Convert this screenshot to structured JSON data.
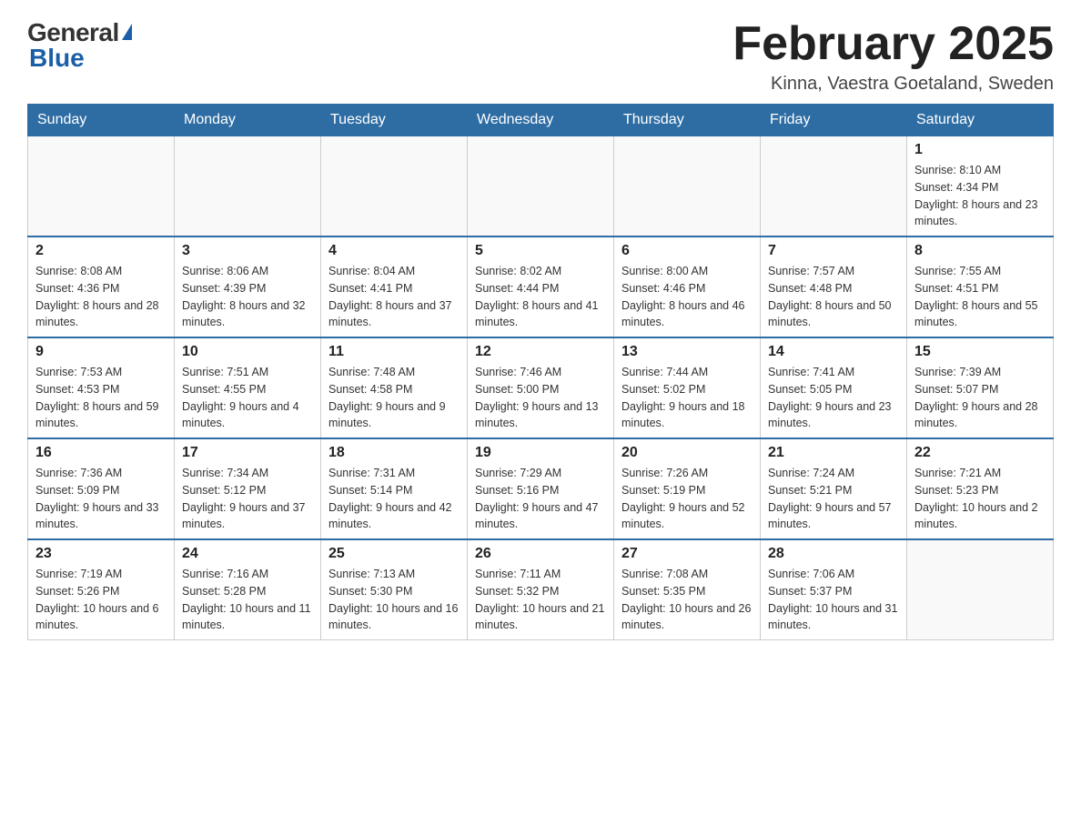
{
  "header": {
    "logo_general": "General",
    "logo_triangle": "▶",
    "logo_blue": "Blue",
    "title": "February 2025",
    "subtitle": "Kinna, Vaestra Goetaland, Sweden"
  },
  "days_of_week": [
    "Sunday",
    "Monday",
    "Tuesday",
    "Wednesday",
    "Thursday",
    "Friday",
    "Saturday"
  ],
  "weeks": [
    [
      {
        "day": "",
        "info": ""
      },
      {
        "day": "",
        "info": ""
      },
      {
        "day": "",
        "info": ""
      },
      {
        "day": "",
        "info": ""
      },
      {
        "day": "",
        "info": ""
      },
      {
        "day": "",
        "info": ""
      },
      {
        "day": "1",
        "info": "Sunrise: 8:10 AM\nSunset: 4:34 PM\nDaylight: 8 hours and 23 minutes."
      }
    ],
    [
      {
        "day": "2",
        "info": "Sunrise: 8:08 AM\nSunset: 4:36 PM\nDaylight: 8 hours and 28 minutes."
      },
      {
        "day": "3",
        "info": "Sunrise: 8:06 AM\nSunset: 4:39 PM\nDaylight: 8 hours and 32 minutes."
      },
      {
        "day": "4",
        "info": "Sunrise: 8:04 AM\nSunset: 4:41 PM\nDaylight: 8 hours and 37 minutes."
      },
      {
        "day": "5",
        "info": "Sunrise: 8:02 AM\nSunset: 4:44 PM\nDaylight: 8 hours and 41 minutes."
      },
      {
        "day": "6",
        "info": "Sunrise: 8:00 AM\nSunset: 4:46 PM\nDaylight: 8 hours and 46 minutes."
      },
      {
        "day": "7",
        "info": "Sunrise: 7:57 AM\nSunset: 4:48 PM\nDaylight: 8 hours and 50 minutes."
      },
      {
        "day": "8",
        "info": "Sunrise: 7:55 AM\nSunset: 4:51 PM\nDaylight: 8 hours and 55 minutes."
      }
    ],
    [
      {
        "day": "9",
        "info": "Sunrise: 7:53 AM\nSunset: 4:53 PM\nDaylight: 8 hours and 59 minutes."
      },
      {
        "day": "10",
        "info": "Sunrise: 7:51 AM\nSunset: 4:55 PM\nDaylight: 9 hours and 4 minutes."
      },
      {
        "day": "11",
        "info": "Sunrise: 7:48 AM\nSunset: 4:58 PM\nDaylight: 9 hours and 9 minutes."
      },
      {
        "day": "12",
        "info": "Sunrise: 7:46 AM\nSunset: 5:00 PM\nDaylight: 9 hours and 13 minutes."
      },
      {
        "day": "13",
        "info": "Sunrise: 7:44 AM\nSunset: 5:02 PM\nDaylight: 9 hours and 18 minutes."
      },
      {
        "day": "14",
        "info": "Sunrise: 7:41 AM\nSunset: 5:05 PM\nDaylight: 9 hours and 23 minutes."
      },
      {
        "day": "15",
        "info": "Sunrise: 7:39 AM\nSunset: 5:07 PM\nDaylight: 9 hours and 28 minutes."
      }
    ],
    [
      {
        "day": "16",
        "info": "Sunrise: 7:36 AM\nSunset: 5:09 PM\nDaylight: 9 hours and 33 minutes."
      },
      {
        "day": "17",
        "info": "Sunrise: 7:34 AM\nSunset: 5:12 PM\nDaylight: 9 hours and 37 minutes."
      },
      {
        "day": "18",
        "info": "Sunrise: 7:31 AM\nSunset: 5:14 PM\nDaylight: 9 hours and 42 minutes."
      },
      {
        "day": "19",
        "info": "Sunrise: 7:29 AM\nSunset: 5:16 PM\nDaylight: 9 hours and 47 minutes."
      },
      {
        "day": "20",
        "info": "Sunrise: 7:26 AM\nSunset: 5:19 PM\nDaylight: 9 hours and 52 minutes."
      },
      {
        "day": "21",
        "info": "Sunrise: 7:24 AM\nSunset: 5:21 PM\nDaylight: 9 hours and 57 minutes."
      },
      {
        "day": "22",
        "info": "Sunrise: 7:21 AM\nSunset: 5:23 PM\nDaylight: 10 hours and 2 minutes."
      }
    ],
    [
      {
        "day": "23",
        "info": "Sunrise: 7:19 AM\nSunset: 5:26 PM\nDaylight: 10 hours and 6 minutes."
      },
      {
        "day": "24",
        "info": "Sunrise: 7:16 AM\nSunset: 5:28 PM\nDaylight: 10 hours and 11 minutes."
      },
      {
        "day": "25",
        "info": "Sunrise: 7:13 AM\nSunset: 5:30 PM\nDaylight: 10 hours and 16 minutes."
      },
      {
        "day": "26",
        "info": "Sunrise: 7:11 AM\nSunset: 5:32 PM\nDaylight: 10 hours and 21 minutes."
      },
      {
        "day": "27",
        "info": "Sunrise: 7:08 AM\nSunset: 5:35 PM\nDaylight: 10 hours and 26 minutes."
      },
      {
        "day": "28",
        "info": "Sunrise: 7:06 AM\nSunset: 5:37 PM\nDaylight: 10 hours and 31 minutes."
      },
      {
        "day": "",
        "info": ""
      }
    ]
  ]
}
